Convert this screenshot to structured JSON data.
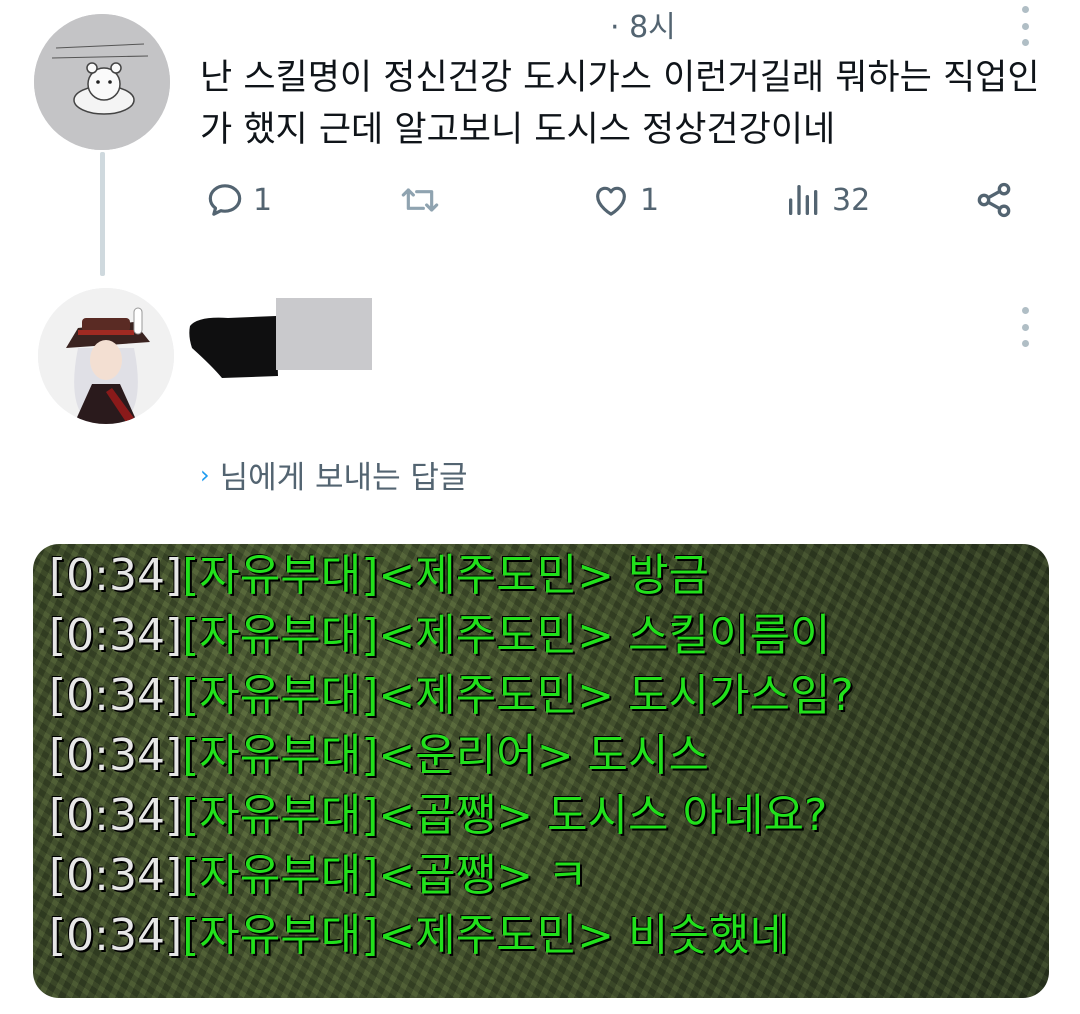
{
  "post": {
    "time": "· 8시",
    "text": "난 스킬명이 정신건강 도시가스 이런거길래 뭐하는 직업인가 했지 근데 알고보니 도시스 정상건강이네",
    "actions": {
      "reply_count": "1",
      "like_count": "1",
      "view_count": "32"
    },
    "icons": [
      "reply-icon",
      "retweet-icon",
      "like-icon",
      "views-icon",
      "share-icon",
      "more-icon"
    ]
  },
  "reply": {
    "replying_to": "님에게 보내는 답글",
    "handle_mark": "›"
  },
  "chat_log": [
    {
      "time": "[0:34]",
      "msg": "[자유부대]<제주도민> 방금"
    },
    {
      "time": "[0:34]",
      "msg": "[자유부대]<제주도민> 스킬이름이"
    },
    {
      "time": "[0:34]",
      "msg": "[자유부대]<제주도민> 도시가스임?"
    },
    {
      "time": "[0:34]",
      "msg": "[자유부대]<운리어> 도시스"
    },
    {
      "time": "[0:34]",
      "msg": "[자유부대]<곱쨍> 도시스 아네요?"
    },
    {
      "time": "[0:34]",
      "msg": "[자유부대]<곱쨍> ㅋ"
    },
    {
      "time": "[0:34]",
      "msg": "[자유부대]<제주도민> 비슷했네"
    }
  ],
  "colors": {
    "text_primary": "#0f1419",
    "text_secondary": "#536471",
    "chat_green": "#22e01c",
    "thread_line": "#cfd9de"
  }
}
